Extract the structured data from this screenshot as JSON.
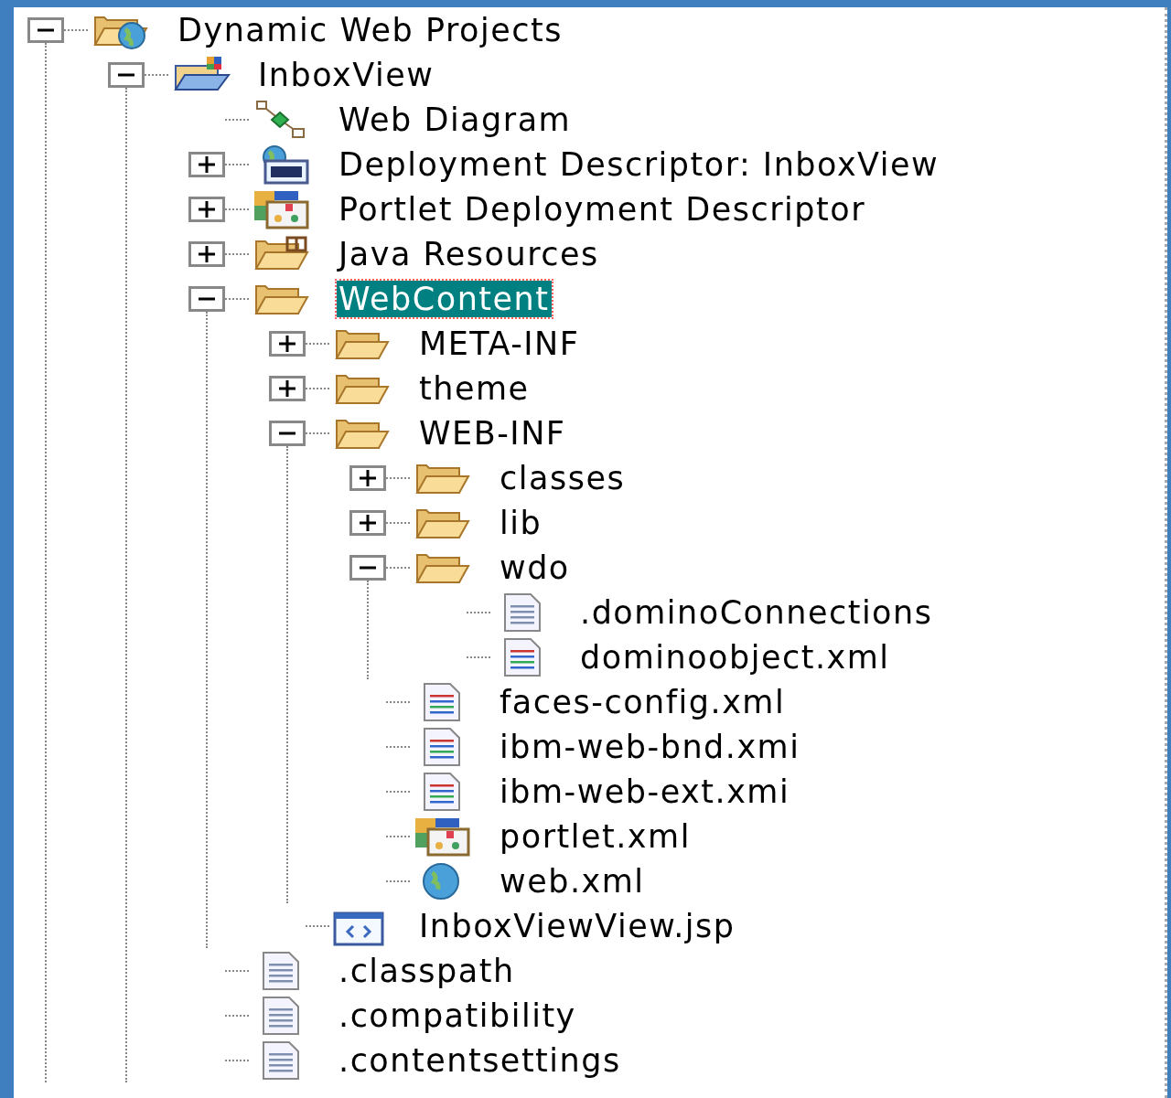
{
  "tree": [
    {
      "label": "Dynamic Web Projects",
      "kind": "projects",
      "expanded": true,
      "selected": false,
      "children": [
        {
          "label": "InboxView",
          "kind": "project",
          "expanded": true,
          "selected": false,
          "children": [
            {
              "label": "Web Diagram",
              "kind": "diagram",
              "selected": false
            },
            {
              "label": "Deployment Descriptor: InboxView",
              "kind": "descriptor",
              "expanded": false,
              "selected": false
            },
            {
              "label": "Portlet Deployment Descriptor",
              "kind": "portlet",
              "expanded": false,
              "selected": false
            },
            {
              "label": "Java Resources",
              "kind": "java-folder",
              "expanded": false,
              "selected": false
            },
            {
              "label": "WebContent",
              "kind": "folder",
              "expanded": true,
              "selected": true,
              "children": [
                {
                  "label": "META-INF",
                  "kind": "folder",
                  "expanded": false,
                  "selected": false
                },
                {
                  "label": "theme",
                  "kind": "folder",
                  "expanded": false,
                  "selected": false
                },
                {
                  "label": "WEB-INF",
                  "kind": "folder",
                  "expanded": true,
                  "selected": false,
                  "children": [
                    {
                      "label": "classes",
                      "kind": "folder",
                      "expanded": false,
                      "selected": false
                    },
                    {
                      "label": "lib",
                      "kind": "folder",
                      "expanded": false,
                      "selected": false
                    },
                    {
                      "label": "wdo",
                      "kind": "folder",
                      "expanded": true,
                      "selected": false,
                      "children": [
                        {
                          "label": ".dominoConnections",
                          "kind": "file",
                          "selected": false
                        },
                        {
                          "label": "dominoobject.xml",
                          "kind": "xml",
                          "selected": false
                        }
                      ]
                    },
                    {
                      "label": "faces-config.xml",
                      "kind": "xml",
                      "selected": false
                    },
                    {
                      "label": "ibm-web-bnd.xmi",
                      "kind": "xml",
                      "selected": false
                    },
                    {
                      "label": "ibm-web-ext.xmi",
                      "kind": "xml",
                      "selected": false
                    },
                    {
                      "label": "portlet.xml",
                      "kind": "portlet",
                      "selected": false
                    },
                    {
                      "label": "web.xml",
                      "kind": "globe",
                      "selected": false
                    }
                  ]
                },
                {
                  "label": "InboxViewView.jsp",
                  "kind": "jsp",
                  "selected": false
                }
              ]
            },
            {
              "label": ".classpath",
              "kind": "file",
              "selected": false
            },
            {
              "label": ".compatibility",
              "kind": "file",
              "selected": false
            },
            {
              "label": ".contentsettings",
              "kind": "file",
              "selected": false
            }
          ]
        }
      ]
    }
  ]
}
